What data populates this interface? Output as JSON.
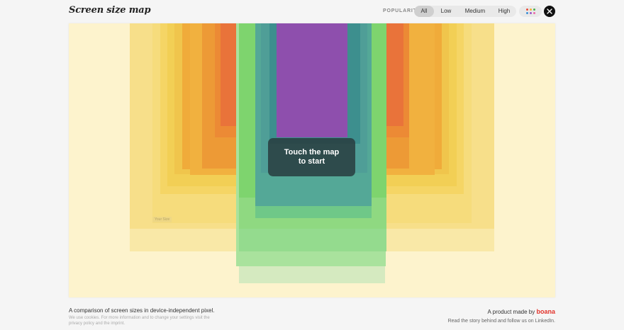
{
  "header": {
    "logo_text": "Screen size map",
    "popularity_label": "POPULARITY",
    "options": [
      "All",
      "Low",
      "Medium",
      "High"
    ],
    "active_option": "All",
    "color_dots": [
      "#e84a3a",
      "#f2b233",
      "#48b04f",
      "#3d8fd6",
      "#9a56c4",
      "#ec6aa8"
    ],
    "close_icon": "close-icon"
  },
  "map": {
    "your_size_label": "Your Size",
    "touch_line1": "Touch the map",
    "touch_line2": "to start",
    "colors": {
      "background": "#fdf3cd",
      "yellow_light": "#f9e8a7",
      "yellow": "#f5d565",
      "yellow_deep": "#f1c94a",
      "orange_light": "#f0ab3a",
      "orange": "#ec8a35",
      "orange_deep": "#e9733a",
      "green_light": "#d5eac0",
      "green": "#94db8e",
      "green_mid": "#7ed46e",
      "teal": "#4f9e97",
      "teal_deep": "#3d8f8e",
      "purple": "#8e4fad"
    }
  },
  "footer": {
    "title": "A comparison of screen sizes in device-independent pixel.",
    "note": "We use cookies. For more information and to change your settings visit the privacy policy and the imprint.",
    "made_by": "A product made by",
    "brand": "boana",
    "story": "Read the story behind and follow us on LinkedIn."
  }
}
